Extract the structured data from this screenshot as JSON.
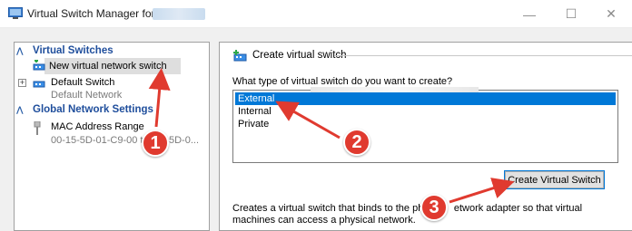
{
  "window": {
    "title": "Virtual Switch Manager for",
    "controls": {
      "minimize": "—",
      "maximize": "☐",
      "close": "✕"
    }
  },
  "sidebar": {
    "virtual_switches_header": "Virtual Switches",
    "new_switch_label": "New virtual network switch",
    "default_switch_label": "Default Switch",
    "default_switch_sub": "Default Network",
    "global_settings_header": "Global Network Settings",
    "mac_range_label": "MAC Address Range",
    "mac_range_start": "00-15-5D-01-C9-00 t",
    "mac_range_end": "5D-0..."
  },
  "main": {
    "header": "Create virtual switch",
    "question": "What type of virtual switch do you want to create?",
    "switch_types": [
      "External",
      "Internal",
      "Private"
    ],
    "selected_type": "External",
    "create_button": "Create Virtual Switch",
    "description_line1_start": "Creates a virtual switch that binds to the phy",
    "description_line1_end": "etwork adapter so that virtual",
    "description_line2": "machines can access a physical network."
  },
  "annotations": {
    "callouts": [
      "1",
      "2",
      "3"
    ],
    "accent_color": "#e03a2f"
  },
  "colors": {
    "selection": "#0078d7",
    "section_header": "#1f4e9c"
  }
}
